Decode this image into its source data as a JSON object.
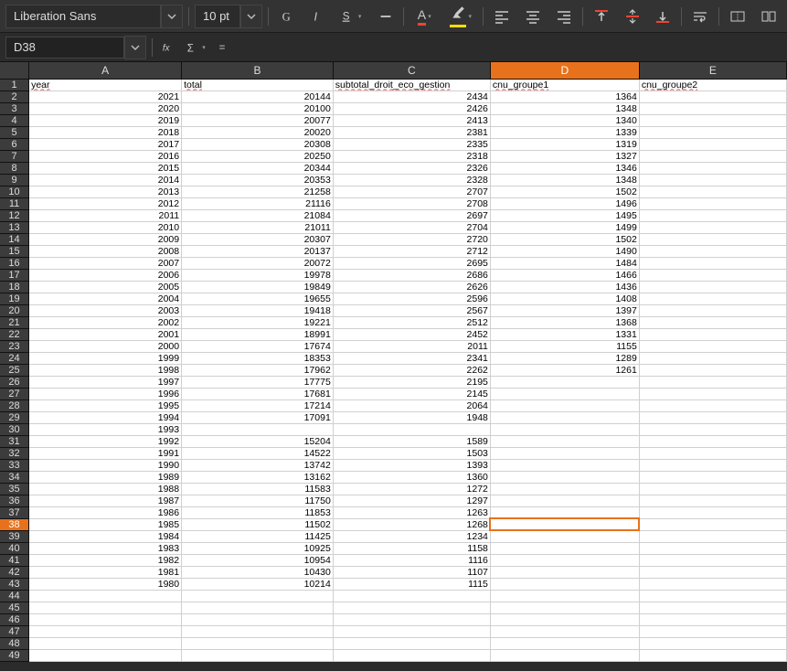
{
  "toolbar": {
    "font_name": "Liberation Sans",
    "font_size": "10 pt"
  },
  "formula_bar": {
    "cell_ref": "D38"
  },
  "sheet": {
    "active_col": "D",
    "active_row": 38,
    "columns": [
      "A",
      "B",
      "C",
      "D",
      "E"
    ],
    "header_row": [
      "year",
      "total",
      "subtotal_droit_eco_gestion",
      "cnu_groupe1",
      "cnu_groupe2"
    ],
    "rows": [
      {
        "n": 2,
        "c": [
          "2021",
          "20144",
          "2434",
          "1364",
          ""
        ]
      },
      {
        "n": 3,
        "c": [
          "2020",
          "20100",
          "2426",
          "1348",
          ""
        ]
      },
      {
        "n": 4,
        "c": [
          "2019",
          "20077",
          "2413",
          "1340",
          ""
        ]
      },
      {
        "n": 5,
        "c": [
          "2018",
          "20020",
          "2381",
          "1339",
          ""
        ]
      },
      {
        "n": 6,
        "c": [
          "2017",
          "20308",
          "2335",
          "1319",
          ""
        ]
      },
      {
        "n": 7,
        "c": [
          "2016",
          "20250",
          "2318",
          "1327",
          ""
        ]
      },
      {
        "n": 8,
        "c": [
          "2015",
          "20344",
          "2326",
          "1346",
          ""
        ]
      },
      {
        "n": 9,
        "c": [
          "2014",
          "20353",
          "2328",
          "1348",
          ""
        ]
      },
      {
        "n": 10,
        "c": [
          "2013",
          "21258",
          "2707",
          "1502",
          ""
        ]
      },
      {
        "n": 11,
        "c": [
          "2012",
          "21116",
          "2708",
          "1496",
          ""
        ]
      },
      {
        "n": 12,
        "c": [
          "2011",
          "21084",
          "2697",
          "1495",
          ""
        ]
      },
      {
        "n": 13,
        "c": [
          "2010",
          "21011",
          "2704",
          "1499",
          ""
        ]
      },
      {
        "n": 14,
        "c": [
          "2009",
          "20307",
          "2720",
          "1502",
          ""
        ]
      },
      {
        "n": 15,
        "c": [
          "2008",
          "20137",
          "2712",
          "1490",
          ""
        ]
      },
      {
        "n": 16,
        "c": [
          "2007",
          "20072",
          "2695",
          "1484",
          ""
        ]
      },
      {
        "n": 17,
        "c": [
          "2006",
          "19978",
          "2686",
          "1466",
          ""
        ]
      },
      {
        "n": 18,
        "c": [
          "2005",
          "19849",
          "2626",
          "1436",
          ""
        ]
      },
      {
        "n": 19,
        "c": [
          "2004",
          "19655",
          "2596",
          "1408",
          ""
        ]
      },
      {
        "n": 20,
        "c": [
          "2003",
          "19418",
          "2567",
          "1397",
          ""
        ]
      },
      {
        "n": 21,
        "c": [
          "2002",
          "19221",
          "2512",
          "1368",
          ""
        ]
      },
      {
        "n": 22,
        "c": [
          "2001",
          "18991",
          "2452",
          "1331",
          ""
        ]
      },
      {
        "n": 23,
        "c": [
          "2000",
          "17674",
          "2011",
          "1155",
          ""
        ]
      },
      {
        "n": 24,
        "c": [
          "1999",
          "18353",
          "2341",
          "1289",
          ""
        ]
      },
      {
        "n": 25,
        "c": [
          "1998",
          "17962",
          "2262",
          "1261",
          ""
        ]
      },
      {
        "n": 26,
        "c": [
          "1997",
          "17775",
          "2195",
          "",
          ""
        ]
      },
      {
        "n": 27,
        "c": [
          "1996",
          "17681",
          "2145",
          "",
          ""
        ]
      },
      {
        "n": 28,
        "c": [
          "1995",
          "17214",
          "2064",
          "",
          ""
        ]
      },
      {
        "n": 29,
        "c": [
          "1994",
          "17091",
          "1948",
          "",
          ""
        ]
      },
      {
        "n": 30,
        "c": [
          "1993",
          "",
          "",
          "",
          ""
        ]
      },
      {
        "n": 31,
        "c": [
          "1992",
          "15204",
          "1589",
          "",
          ""
        ]
      },
      {
        "n": 32,
        "c": [
          "1991",
          "14522",
          "1503",
          "",
          ""
        ]
      },
      {
        "n": 33,
        "c": [
          "1990",
          "13742",
          "1393",
          "",
          ""
        ]
      },
      {
        "n": 34,
        "c": [
          "1989",
          "13162",
          "1360",
          "",
          ""
        ]
      },
      {
        "n": 35,
        "c": [
          "1988",
          "11583",
          "1272",
          "",
          ""
        ]
      },
      {
        "n": 36,
        "c": [
          "1987",
          "11750",
          "1297",
          "",
          ""
        ]
      },
      {
        "n": 37,
        "c": [
          "1986",
          "11853",
          "1263",
          "",
          ""
        ]
      },
      {
        "n": 38,
        "c": [
          "1985",
          "11502",
          "1268",
          "",
          ""
        ]
      },
      {
        "n": 39,
        "c": [
          "1984",
          "11425",
          "1234",
          "",
          ""
        ]
      },
      {
        "n": 40,
        "c": [
          "1983",
          "10925",
          "1158",
          "",
          ""
        ]
      },
      {
        "n": 41,
        "c": [
          "1982",
          "10954",
          "1116",
          "",
          ""
        ]
      },
      {
        "n": 42,
        "c": [
          "1981",
          "10430",
          "1107",
          "",
          ""
        ]
      },
      {
        "n": 43,
        "c": [
          "1980",
          "10214",
          "1115",
          "",
          ""
        ]
      },
      {
        "n": 44,
        "c": [
          "",
          "",
          "",
          "",
          ""
        ]
      },
      {
        "n": 45,
        "c": [
          "",
          "",
          "",
          "",
          ""
        ]
      },
      {
        "n": 46,
        "c": [
          "",
          "",
          "",
          "",
          ""
        ]
      },
      {
        "n": 47,
        "c": [
          "",
          "",
          "",
          "",
          ""
        ]
      },
      {
        "n": 48,
        "c": [
          "",
          "",
          "",
          "",
          ""
        ]
      },
      {
        "n": 49,
        "c": [
          "",
          "",
          "",
          "",
          ""
        ]
      }
    ]
  }
}
